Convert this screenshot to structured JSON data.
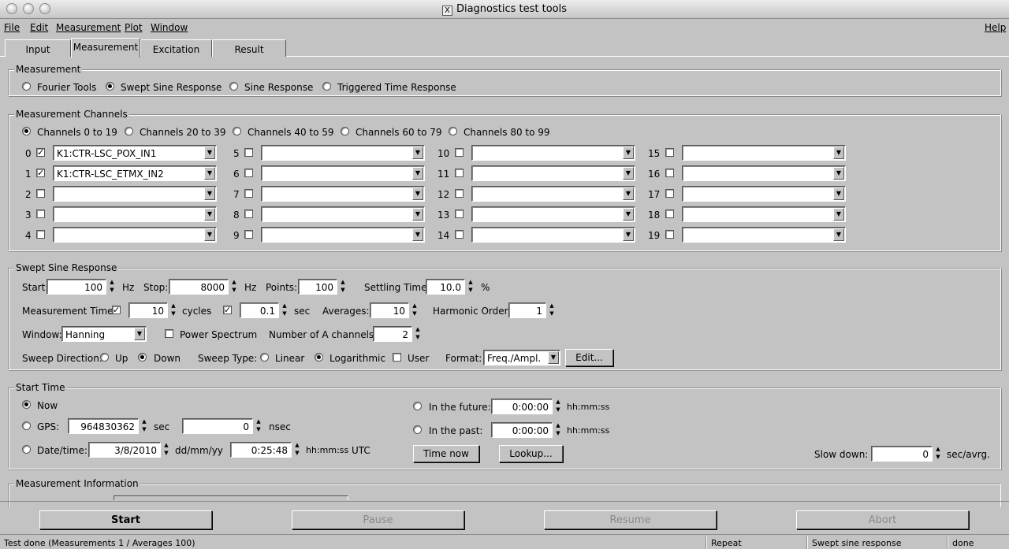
{
  "window": {
    "title": "Diagnostics test tools"
  },
  "menubar": {
    "file": "File",
    "edit": "Edit",
    "measurement": "Measurement",
    "plot": "Plot",
    "window": "Window",
    "help": "Help"
  },
  "tabs": [
    "Input",
    "Measurement",
    "Excitation",
    "Result"
  ],
  "measurement": {
    "title": "Measurement",
    "options": [
      "Fourier Tools",
      "Swept Sine Response",
      "Sine Response",
      "Triggered Time Response"
    ],
    "selected": "Swept Sine Response"
  },
  "channels": {
    "title": "Measurement Channels",
    "ranges": [
      "Channels 0 to 19",
      "Channels 20 to 39",
      "Channels 40 to 59",
      "Channels 60 to 79",
      "Channels 80 to 99"
    ],
    "items": [
      {
        "num": "0",
        "checked": true,
        "value": "K1:CTR-LSC_POX_IN1"
      },
      {
        "num": "1",
        "checked": true,
        "value": "K1:CTR-LSC_ETMX_IN2"
      },
      {
        "num": "2",
        "checked": false,
        "value": ""
      },
      {
        "num": "3",
        "checked": false,
        "value": ""
      },
      {
        "num": "4",
        "checked": false,
        "value": ""
      },
      {
        "num": "5",
        "checked": false,
        "value": ""
      },
      {
        "num": "6",
        "checked": false,
        "value": ""
      },
      {
        "num": "7",
        "checked": false,
        "value": ""
      },
      {
        "num": "8",
        "checked": false,
        "value": ""
      },
      {
        "num": "9",
        "checked": false,
        "value": ""
      },
      {
        "num": "10",
        "checked": false,
        "value": ""
      },
      {
        "num": "11",
        "checked": false,
        "value": ""
      },
      {
        "num": "12",
        "checked": false,
        "value": ""
      },
      {
        "num": "13",
        "checked": false,
        "value": ""
      },
      {
        "num": "14",
        "checked": false,
        "value": ""
      },
      {
        "num": "15",
        "checked": false,
        "value": ""
      },
      {
        "num": "16",
        "checked": false,
        "value": ""
      },
      {
        "num": "17",
        "checked": false,
        "value": ""
      },
      {
        "num": "18",
        "checked": false,
        "value": ""
      },
      {
        "num": "19",
        "checked": false,
        "value": ""
      }
    ]
  },
  "swept": {
    "title": "Swept Sine Response",
    "start_label": "Start:",
    "start": "100",
    "hz": "Hz",
    "stop_label": "Stop:",
    "stop": "8000",
    "hz2": "Hz",
    "points_label": "Points:",
    "points": "100",
    "settling_label": "Settling Time:",
    "settling": "10.0",
    "pct": "%",
    "mtime_label": "Measurement Time:",
    "cycles_val": "10",
    "cycles": "cycles",
    "sec_val": "0.1",
    "sec": "sec",
    "averages_label": "Averages:",
    "averages": "10",
    "harmonic_label": "Harmonic Order:",
    "harmonic": "1",
    "window_label": "Window:",
    "window": "Hanning",
    "power_spectrum": "Power Spectrum",
    "num_a_label": "Number of A channels:",
    "num_a": "2",
    "sweep_dir_label": "Sweep Direction:",
    "up": "Up",
    "down": "Down",
    "sweep_type_label": "Sweep Type:",
    "linear": "Linear",
    "log": "Logarithmic",
    "user": "User",
    "format_label": "Format:",
    "format": "Freq./Ampl.",
    "edit": "Edit..."
  },
  "start_time": {
    "title": "Start Time",
    "now": "Now",
    "gps": "GPS:",
    "gps_val": "964830362",
    "sec": "sec",
    "nsec_val": "0",
    "nsec": "nsec",
    "datetime": "Date/time:",
    "date_val": "3/8/2010",
    "date_fmt": "dd/mm/yy",
    "time_val": "0:25:48",
    "time_fmt": "hh:mm:ss",
    "utc": "UTC",
    "future": "In the future:",
    "future_val": "0:00:00",
    "future_fmt": "hh:mm:ss",
    "past": "In the past:",
    "past_val": "0:00:00",
    "past_fmt": "hh:mm:ss",
    "time_now": "Time now",
    "lookup": "Lookup...",
    "slow_down": "Slow down:",
    "slow_val": "0",
    "slow_unit": "sec/avrg."
  },
  "info": {
    "title": "Measurement Information"
  },
  "actions": {
    "start": "Start",
    "pause": "Pause",
    "resume": "Resume",
    "abort": "Abort"
  },
  "status": {
    "message": "Test done (Measurements 1 / Averages 100)",
    "repeat": "Repeat",
    "mode": "Swept sine response",
    "state": "done"
  }
}
